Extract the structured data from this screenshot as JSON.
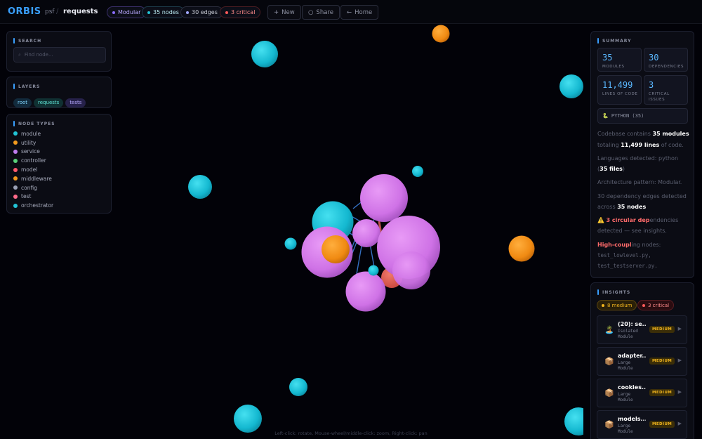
{
  "app": {
    "logo": "ORBIS",
    "owner": "psf",
    "sep": "/",
    "repo": "requests"
  },
  "topbar": {
    "pills": [
      {
        "label": "Modular",
        "dot": "#8b6cff",
        "border": "#3a2f6a",
        "color": "#b8a8ff"
      },
      {
        "label": "35 nodes",
        "dot": "#22c4d6",
        "border": "#1d3b4a",
        "color": "#b8e8f0"
      },
      {
        "label": "30 edges",
        "dot": "#a0a8ff",
        "border": "#2a2d3c",
        "color": "#c9ccd6"
      },
      {
        "label": "3 critical",
        "dot": "#ff5a5a",
        "border": "#4a1d22",
        "color": "#ff8b8b"
      }
    ],
    "buttons": [
      {
        "label": "New",
        "icon": "+"
      },
      {
        "label": "Share",
        "icon": "○"
      },
      {
        "label": "Home",
        "icon": "←"
      }
    ]
  },
  "left": {
    "search": {
      "title": "SEARCH",
      "placeholder": "Find node...",
      "icon": "⌕"
    },
    "layers": {
      "title": "LAYERS",
      "items": [
        {
          "label": "root",
          "bg": "#122a3c",
          "color": "#7fd6ff"
        },
        {
          "label": "requests",
          "bg": "#103032",
          "color": "#5fe3d6"
        },
        {
          "label": "tests",
          "bg": "#26214a",
          "color": "#b6a8ff"
        }
      ]
    },
    "node_types": {
      "title": "NODE TYPES",
      "items": [
        {
          "label": "module",
          "color": "#22c4d6"
        },
        {
          "label": "utility",
          "color": "#f29a1e"
        },
        {
          "label": "service",
          "color": "#c07cf0"
        },
        {
          "label": "controller",
          "color": "#5ad17a"
        },
        {
          "label": "model",
          "color": "#ff5a6e"
        },
        {
          "label": "middleware",
          "color": "#f29a1e"
        },
        {
          "label": "config",
          "color": "#9aa0b4"
        },
        {
          "label": "test",
          "color": "#ff6b8a"
        },
        {
          "label": "orchestrator",
          "color": "#22c4d6"
        }
      ]
    }
  },
  "canvas": {
    "hint": "Left-click: rotate, Mouse-wheel/middle-click: zoom, Right-click: pan",
    "colors": {
      "module": "#18c6dc",
      "utility": "#f7941d",
      "service": "#d57ef0",
      "edge": "#3a7bd5",
      "critical_edge": "#e0605a"
    }
  },
  "summary": {
    "title": "SUMMARY",
    "stats": [
      {
        "value": "35",
        "label": "MODULES"
      },
      {
        "value": "30",
        "label": "DEPENDENCIES"
      },
      {
        "value": "11,499",
        "label": "LINES OF CODE"
      },
      {
        "value": "3",
        "label": "CRITICAL ISSUES"
      }
    ],
    "language": "🐍 PYTHON (35)",
    "lines": {
      "l1a": "Codebase contains ",
      "l1b": "35 modules",
      "l2a": "totaling ",
      "l2b": "11,499 lines",
      "l2c": " of code.",
      "l3": "Languages detected: python",
      "l4a": "(",
      "l4b": "35 files",
      "l4c": ")",
      "l5": "Architecture pattern: Modular.",
      "l6": "30 dependency edges detected",
      "l7a": "across ",
      "l7b": "35 nodes",
      "l8a": "⚠️ ",
      "l8b": "3 circular dep",
      "l8c": "endencies",
      "l9": "detected — see insights.",
      "l10a": "High-coupl",
      "l10b": "ing nodes:",
      "l11": "test_lowlevel.py,",
      "l12": "test_testserver.py."
    }
  },
  "insights": {
    "title": "INSIGHTS",
    "badges": [
      {
        "label": "8 medium",
        "dot": "#f2b51e",
        "bg": "#2a2008",
        "border": "#5a4410",
        "color": "#f2b51e"
      },
      {
        "label": "3 critical",
        "dot": "#ff5a5a",
        "bg": "#2a0c10",
        "border": "#5a1d22",
        "color": "#ff8b8b"
      }
    ],
    "cards": [
      {
        "icon": "🏝️",
        "title": "(20): se...",
        "sub": "Isolated Module",
        "severity": "MEDIUM"
      },
      {
        "icon": "📦",
        "title": "adapter...",
        "sub": "Large Module",
        "severity": "MEDIUM"
      },
      {
        "icon": "📦",
        "title": "cookies....",
        "sub": "Large Module",
        "severity": "MEDIUM"
      },
      {
        "icon": "📦",
        "title": "models....",
        "sub": "Large Module",
        "severity": "MEDIUM"
      }
    ]
  }
}
